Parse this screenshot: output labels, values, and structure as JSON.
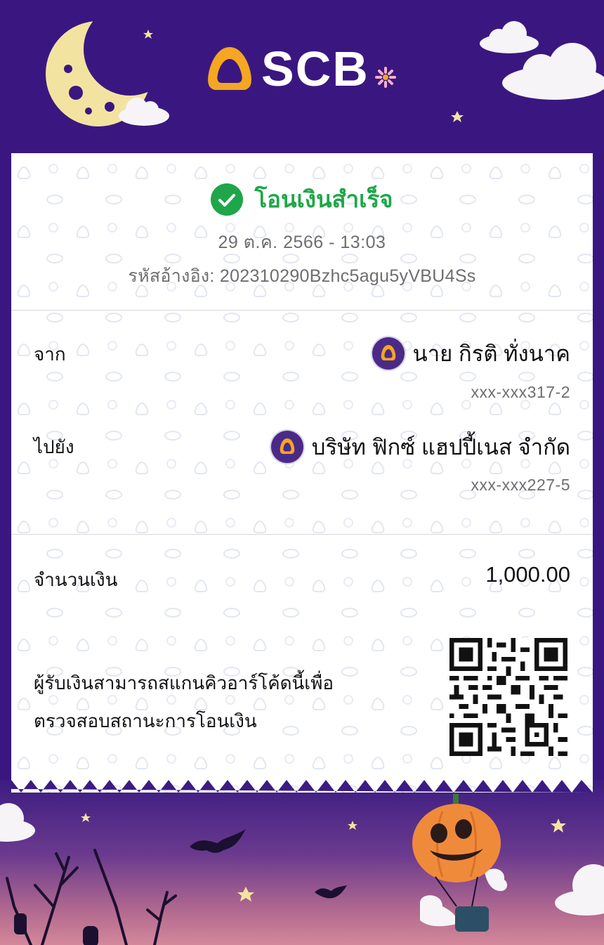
{
  "header": {
    "brand": "SCB"
  },
  "status": {
    "title": "โอนเงินสำเร็จ",
    "icon": "check-circle-icon",
    "color": "#1fa649"
  },
  "transaction": {
    "date": "29 ต.ค. 2566 - 13:03",
    "reference": "รหัสอ้างอิง: 202310290Bzhc5agu5yVBU4Ss"
  },
  "from": {
    "label": "จาก",
    "name": "นาย กิรติ ทั่งนาค",
    "account": "xxx-xxx317-2"
  },
  "to": {
    "label": "ไปยัง",
    "name": "บริษัท ฟิกซ์ แฮปปี้เนส จำกัด",
    "account": "xxx-xxx227-5"
  },
  "amount": {
    "label": "จำนวนเงิน",
    "value": "1,000.00"
  },
  "qr_note": {
    "line1": "ผู้รับเงินสามารถสแกนคิวอาร์โค้ดนี้เพื่อ",
    "line2": "ตรวจสอบสถานะการโอนเงิน"
  },
  "colors": {
    "brand_purple": "#3a1780",
    "brand_gold": "#f5a623",
    "success_green": "#1fa649"
  }
}
